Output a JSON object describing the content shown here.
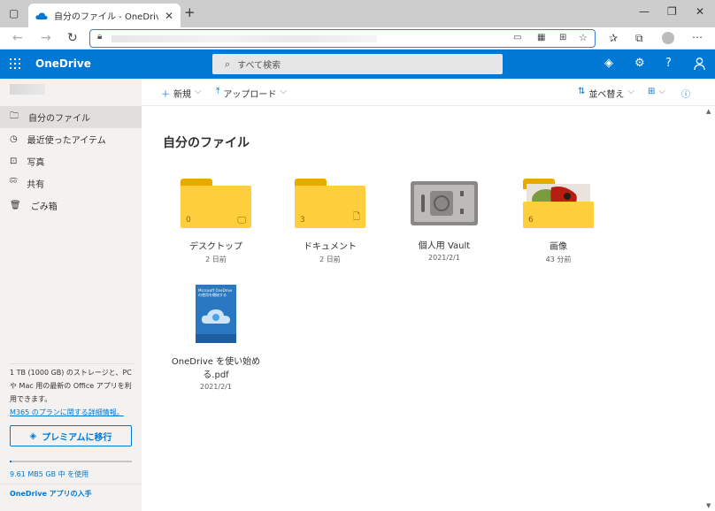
{
  "browser": {
    "tab_title": "自分のファイル - OneDrive",
    "new_tab": "+",
    "win_min": "—",
    "win_max": "❐",
    "win_close": "✕",
    "more": "⋯"
  },
  "appbar": {
    "brand": "OneDrive",
    "search_placeholder": "すべて検索",
    "help": "?"
  },
  "sidebar": {
    "items": [
      {
        "label": "自分のファイル",
        "icon": "folder-icon"
      },
      {
        "label": "最近使ったアイテム",
        "icon": "clock-icon"
      },
      {
        "label": "写真",
        "icon": "photo-icon"
      },
      {
        "label": "共有",
        "icon": "share-icon"
      },
      {
        "label": "ごみ箱",
        "icon": "trash-icon"
      }
    ],
    "storage_text": "1 TB (1000 GB) のストレージと、PC や Mac 用の最新の Office アプリを利用できます。",
    "plan_link": "M365 のプランに関する詳細情報。",
    "premium_button": "プレミアムに移行",
    "usage": "9.61 MB5 GB 中 を使用",
    "get_apps": "OneDrive アプリの入手"
  },
  "commandbar": {
    "new": "新規",
    "upload": "アップロード",
    "sort": "並べ替え"
  },
  "main": {
    "title": "自分のファイル",
    "items": [
      {
        "name": "デスクトップ",
        "date": "2 日前",
        "count": "0",
        "type": "folder"
      },
      {
        "name": "ドキュメント",
        "date": "2 日前",
        "count": "3",
        "type": "folder"
      },
      {
        "name": "個人用 Vault",
        "date": "2021/2/1",
        "type": "vault"
      },
      {
        "name": "画像",
        "date": "43 分前",
        "count": "6",
        "type": "folder"
      },
      {
        "name": "OneDrive を使い始める.pdf",
        "date": "2021/2/1",
        "type": "pdf"
      }
    ],
    "pdf_thumb_text": "Microsoft OneDrive の使用を開始する"
  },
  "colors": {
    "accent": "#0078d4",
    "folder": "#ffce3d",
    "sidebar_bg": "#f3f2f1"
  }
}
